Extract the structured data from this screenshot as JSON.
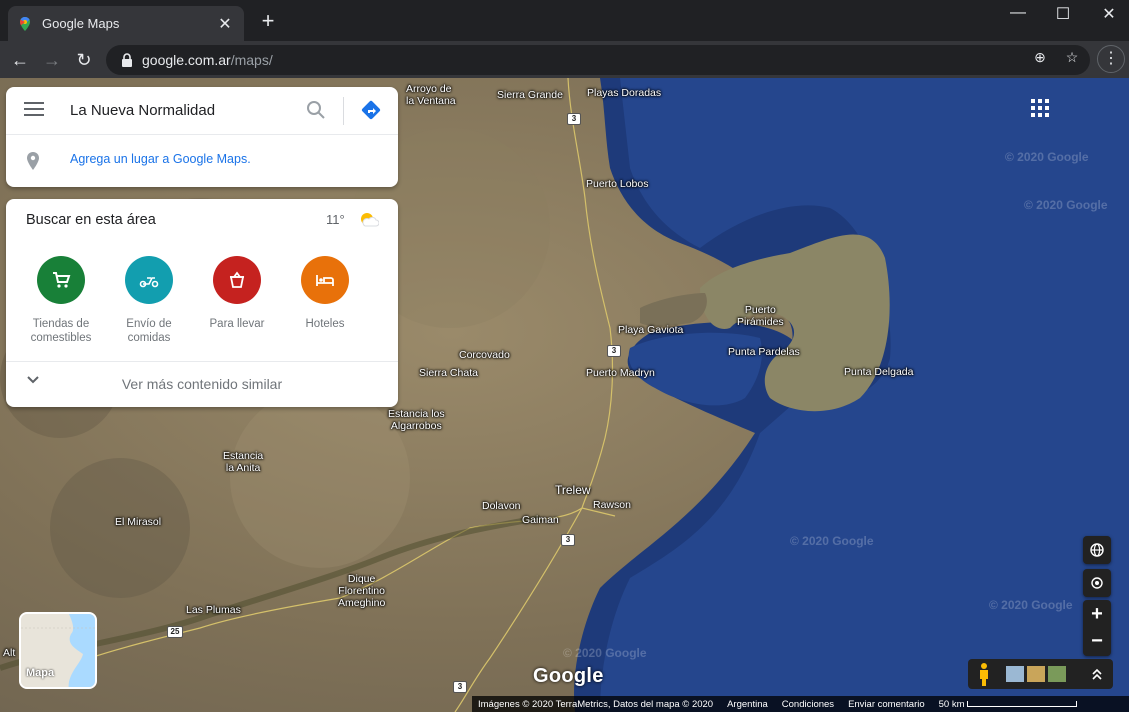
{
  "browser": {
    "tab_title": "Google Maps",
    "tab_close": "✕",
    "new_tab": "+",
    "url_host": "google.com.ar",
    "url_path": "/maps/"
  },
  "search": {
    "query": "La Nueva Normalidad",
    "add_place": "Agrega un lugar a Google Maps."
  },
  "area": {
    "title": "Buscar en esta área",
    "temperature": "11°",
    "categories": [
      {
        "label": "Tiendas de\ncomestibles",
        "color": "#188038",
        "icon": "cart-icon"
      },
      {
        "label": "Envío de\ncomidas",
        "color": "#129eaf",
        "icon": "scooter-icon"
      },
      {
        "label": "Para llevar",
        "color": "#c5221f",
        "icon": "takeout-icon"
      },
      {
        "label": "Hoteles",
        "color": "#e8710a",
        "icon": "bed-icon"
      }
    ],
    "more": "Ver más contenido similar"
  },
  "map": {
    "labels": {
      "arroyo": "Arroyo de\nla Ventana",
      "sierra_grande": "Sierra Grande",
      "playas_doradas": "Playas Doradas",
      "puerto_lobos": "Puerto Lobos",
      "puerto_piramides": "Puerto\nPirámides",
      "playa_gaviota": "Playa Gaviota",
      "punta_pardelas": "Punta Pardelas",
      "corcovado": "Corcovado",
      "sierra_chata": "Sierra Chata",
      "puerto_madryn": "Puerto Madryn",
      "punta_delgada": "Punta Delgada",
      "estancia_algarrobos": "Estancia los\nAlgarrobos",
      "estancia_anita": "Estancia\nla Anita",
      "trelew": "Trelew",
      "dolavon": "Dolavon",
      "rawson": "Rawson",
      "gaiman": "Gaiman",
      "el_mirasol": "El Mirasol",
      "dique": "Dique\nFlorentino\nAmeghino",
      "las_plumas": "Las Plumas",
      "alt": "Alt"
    },
    "routes": [
      "3",
      "3",
      "3",
      "3",
      "25",
      "3"
    ],
    "watermark": "© 2020 Google",
    "minimap_label": "Mapa",
    "logo": "Google",
    "attribution": {
      "imagery": "Imágenes © 2020 TerraMetrics, Datos del mapa © 2020",
      "country": "Argentina",
      "terms": "Condiciones",
      "feedback": "Enviar comentario",
      "scale": "50 km"
    }
  }
}
